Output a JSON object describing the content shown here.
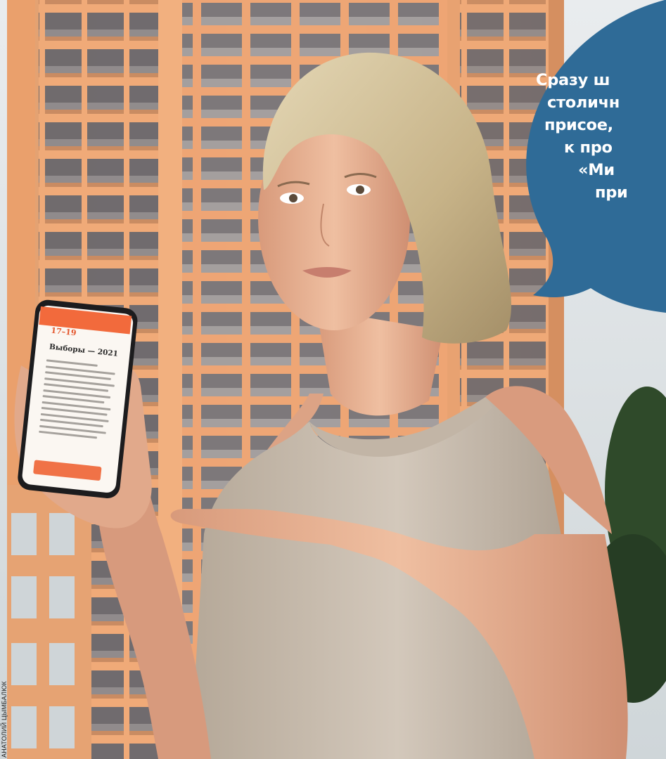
{
  "bubble": {
    "lines": [
      "Сразу ш",
      "столичн",
      "присое,",
      "к про",
      "«Ми",
      "при"
    ],
    "color": "#2f6b97"
  },
  "phone": {
    "date": "17–19",
    "heading": "Выборы — 2021"
  },
  "credit": "АНАТОЛИЙ ЦЫМБАЛЮК",
  "colors": {
    "building": "#f0a774",
    "balcony": "#5b5a60",
    "sky": "#dfe3e6",
    "top": "#c8bdb1",
    "skin": "#e8b396",
    "hair": "#cdbb94"
  }
}
